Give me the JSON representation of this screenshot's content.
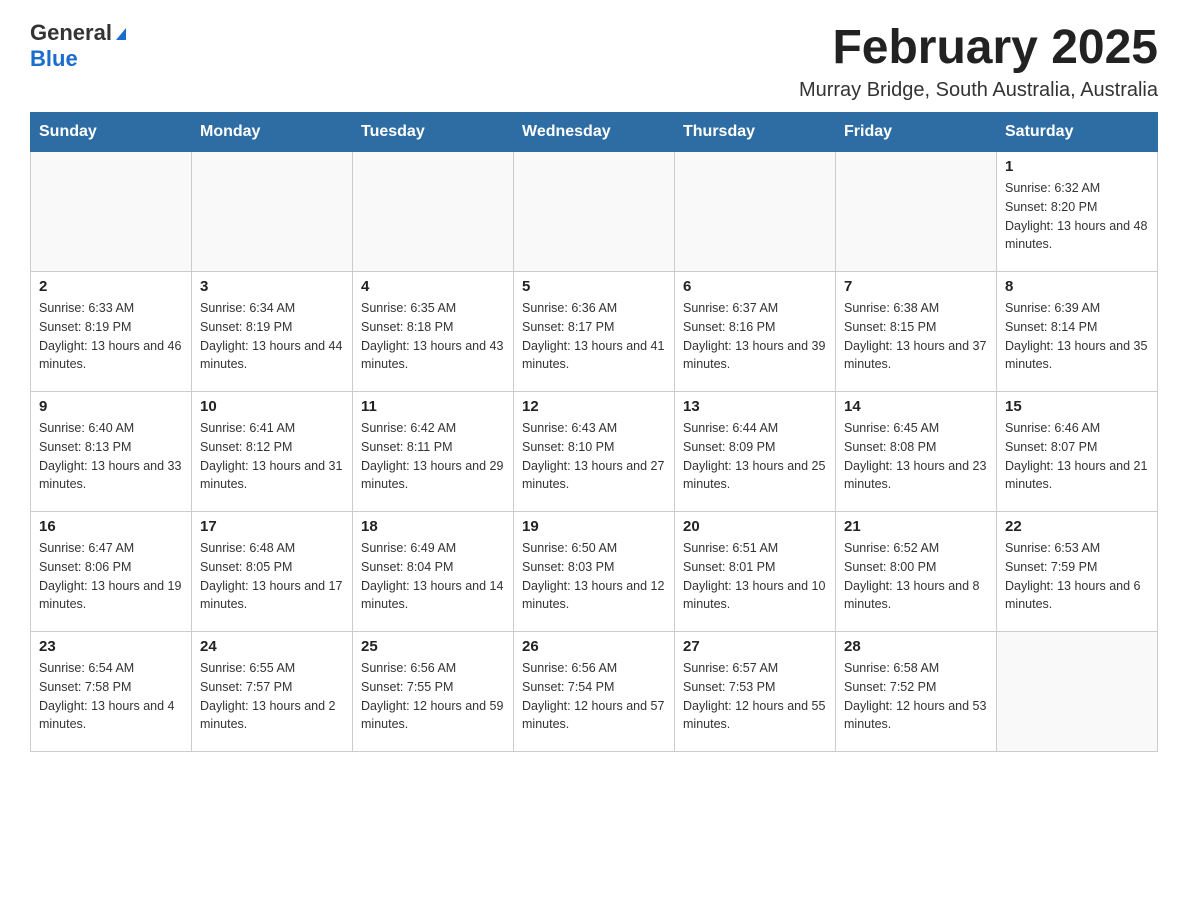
{
  "header": {
    "logo_general": "General",
    "logo_blue": "Blue",
    "title": "February 2025",
    "subtitle": "Murray Bridge, South Australia, Australia"
  },
  "calendar": {
    "days_of_week": [
      "Sunday",
      "Monday",
      "Tuesday",
      "Wednesday",
      "Thursday",
      "Friday",
      "Saturday"
    ],
    "weeks": [
      [
        {
          "day": "",
          "info": ""
        },
        {
          "day": "",
          "info": ""
        },
        {
          "day": "",
          "info": ""
        },
        {
          "day": "",
          "info": ""
        },
        {
          "day": "",
          "info": ""
        },
        {
          "day": "",
          "info": ""
        },
        {
          "day": "1",
          "info": "Sunrise: 6:32 AM\nSunset: 8:20 PM\nDaylight: 13 hours and 48 minutes."
        }
      ],
      [
        {
          "day": "2",
          "info": "Sunrise: 6:33 AM\nSunset: 8:19 PM\nDaylight: 13 hours and 46 minutes."
        },
        {
          "day": "3",
          "info": "Sunrise: 6:34 AM\nSunset: 8:19 PM\nDaylight: 13 hours and 44 minutes."
        },
        {
          "day": "4",
          "info": "Sunrise: 6:35 AM\nSunset: 8:18 PM\nDaylight: 13 hours and 43 minutes."
        },
        {
          "day": "5",
          "info": "Sunrise: 6:36 AM\nSunset: 8:17 PM\nDaylight: 13 hours and 41 minutes."
        },
        {
          "day": "6",
          "info": "Sunrise: 6:37 AM\nSunset: 8:16 PM\nDaylight: 13 hours and 39 minutes."
        },
        {
          "day": "7",
          "info": "Sunrise: 6:38 AM\nSunset: 8:15 PM\nDaylight: 13 hours and 37 minutes."
        },
        {
          "day": "8",
          "info": "Sunrise: 6:39 AM\nSunset: 8:14 PM\nDaylight: 13 hours and 35 minutes."
        }
      ],
      [
        {
          "day": "9",
          "info": "Sunrise: 6:40 AM\nSunset: 8:13 PM\nDaylight: 13 hours and 33 minutes."
        },
        {
          "day": "10",
          "info": "Sunrise: 6:41 AM\nSunset: 8:12 PM\nDaylight: 13 hours and 31 minutes."
        },
        {
          "day": "11",
          "info": "Sunrise: 6:42 AM\nSunset: 8:11 PM\nDaylight: 13 hours and 29 minutes."
        },
        {
          "day": "12",
          "info": "Sunrise: 6:43 AM\nSunset: 8:10 PM\nDaylight: 13 hours and 27 minutes."
        },
        {
          "day": "13",
          "info": "Sunrise: 6:44 AM\nSunset: 8:09 PM\nDaylight: 13 hours and 25 minutes."
        },
        {
          "day": "14",
          "info": "Sunrise: 6:45 AM\nSunset: 8:08 PM\nDaylight: 13 hours and 23 minutes."
        },
        {
          "day": "15",
          "info": "Sunrise: 6:46 AM\nSunset: 8:07 PM\nDaylight: 13 hours and 21 minutes."
        }
      ],
      [
        {
          "day": "16",
          "info": "Sunrise: 6:47 AM\nSunset: 8:06 PM\nDaylight: 13 hours and 19 minutes."
        },
        {
          "day": "17",
          "info": "Sunrise: 6:48 AM\nSunset: 8:05 PM\nDaylight: 13 hours and 17 minutes."
        },
        {
          "day": "18",
          "info": "Sunrise: 6:49 AM\nSunset: 8:04 PM\nDaylight: 13 hours and 14 minutes."
        },
        {
          "day": "19",
          "info": "Sunrise: 6:50 AM\nSunset: 8:03 PM\nDaylight: 13 hours and 12 minutes."
        },
        {
          "day": "20",
          "info": "Sunrise: 6:51 AM\nSunset: 8:01 PM\nDaylight: 13 hours and 10 minutes."
        },
        {
          "day": "21",
          "info": "Sunrise: 6:52 AM\nSunset: 8:00 PM\nDaylight: 13 hours and 8 minutes."
        },
        {
          "day": "22",
          "info": "Sunrise: 6:53 AM\nSunset: 7:59 PM\nDaylight: 13 hours and 6 minutes."
        }
      ],
      [
        {
          "day": "23",
          "info": "Sunrise: 6:54 AM\nSunset: 7:58 PM\nDaylight: 13 hours and 4 minutes."
        },
        {
          "day": "24",
          "info": "Sunrise: 6:55 AM\nSunset: 7:57 PM\nDaylight: 13 hours and 2 minutes."
        },
        {
          "day": "25",
          "info": "Sunrise: 6:56 AM\nSunset: 7:55 PM\nDaylight: 12 hours and 59 minutes."
        },
        {
          "day": "26",
          "info": "Sunrise: 6:56 AM\nSunset: 7:54 PM\nDaylight: 12 hours and 57 minutes."
        },
        {
          "day": "27",
          "info": "Sunrise: 6:57 AM\nSunset: 7:53 PM\nDaylight: 12 hours and 55 minutes."
        },
        {
          "day": "28",
          "info": "Sunrise: 6:58 AM\nSunset: 7:52 PM\nDaylight: 12 hours and 53 minutes."
        },
        {
          "day": "",
          "info": ""
        }
      ]
    ]
  }
}
